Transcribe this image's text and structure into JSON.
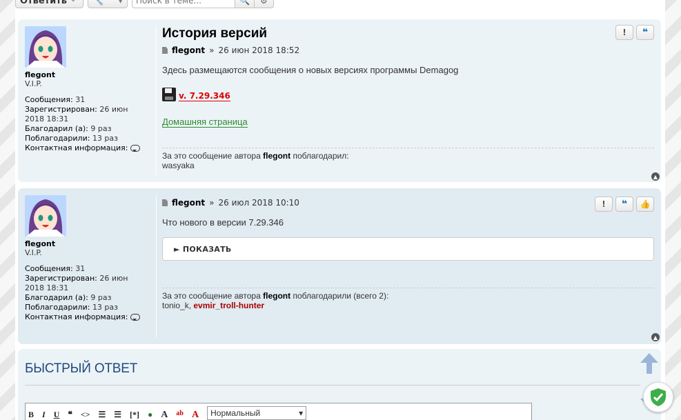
{
  "toolbar": {
    "reply_label": "Ответить",
    "search_placeholder": "Поиск в теме..."
  },
  "posts": [
    {
      "title": "История версий",
      "author": "flegont",
      "meta_sep": "»",
      "date": "26 июн 2018 18:52",
      "profile": {
        "name": "flegont",
        "rank": "V.I.P.",
        "posts_label": "Сообщения:",
        "posts": "31",
        "registered_label": "Зарегистрирован:",
        "registered": "26 июн 2018 18:31",
        "thanked_label": "Благодарил (а):",
        "thanked": "9 раз",
        "got_thanks_label": "Поблагодарили:",
        "got_thanks": "13 раз",
        "contact_label": "Контактная информация:"
      },
      "text": "Здесь размещаются сообщения о новых версиях программы Demagog",
      "download_label": "v. 7.29.346",
      "home_link": "Домашняя страница",
      "thanks_prefix": "За это сообщение автора",
      "thanks_author": "flegont",
      "thanks_suffix": "поблагодарил:",
      "thanks_users": "wasyaka"
    },
    {
      "author": "flegont",
      "meta_sep": "»",
      "date": "26 июл 2018 10:10",
      "profile": {
        "name": "flegont",
        "rank": "V.I.P.",
        "posts_label": "Сообщения:",
        "posts": "31",
        "registered_label": "Зарегистрирован:",
        "registered": "26 июн 2018 18:31",
        "thanked_label": "Благодарил (а):",
        "thanked": "9 раз",
        "got_thanks_label": "Поблагодарили:",
        "got_thanks": "13 раз",
        "contact_label": "Контактная информация:"
      },
      "text": "Что нового в версии 7.29.346",
      "spoiler_label": "► ПОКАЗАТЬ",
      "thanks_prefix": "За это сообщение автора",
      "thanks_author": "flegont",
      "thanks_suffix": "поблагодарили (всего 2):",
      "thanks_user1": "tonio_k,",
      "thanks_user2": "evmir_troll-hunter"
    }
  ],
  "quick_reply": {
    "title": "БЫСТРЫЙ ОТВЕТ",
    "font_size_select": "Нормальный"
  },
  "colors": {
    "post_bg_1": "#ecf3f7",
    "post_bg_2": "#e1ebf2",
    "download_red": "#dd0000",
    "home_green": "#2d8a2d",
    "quote_blue": "#1a6fb5"
  }
}
